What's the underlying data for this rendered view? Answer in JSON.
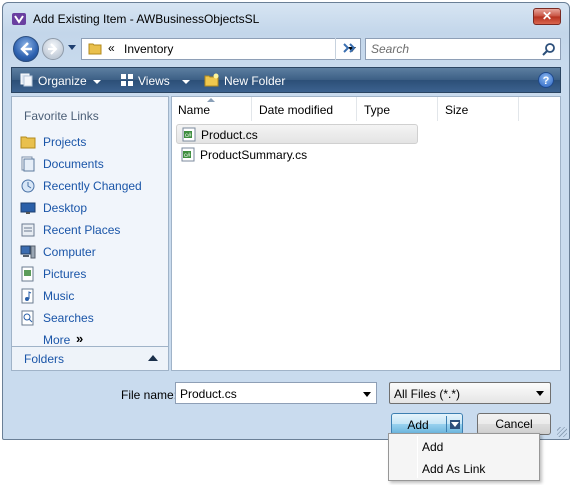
{
  "window": {
    "title": "Add Existing Item - AWBusinessObjectsSL",
    "close_label": "✕"
  },
  "nav": {
    "breadcrumb_prefix": "«",
    "current_folder": "Inventory",
    "search_placeholder": "Search"
  },
  "toolbar": {
    "organize_label": "Organize",
    "views_label": "Views",
    "new_folder_label": "New Folder",
    "help_label": "?"
  },
  "sidebar": {
    "header": "Favorite Links",
    "items": [
      {
        "label": "Projects",
        "icon": "folder-icon"
      },
      {
        "label": "Documents",
        "icon": "documents-icon"
      },
      {
        "label": "Recently Changed",
        "icon": "recently-changed-icon"
      },
      {
        "label": "Desktop",
        "icon": "desktop-icon"
      },
      {
        "label": "Recent Places",
        "icon": "recent-places-icon"
      },
      {
        "label": "Computer",
        "icon": "computer-icon"
      },
      {
        "label": "Pictures",
        "icon": "pictures-icon"
      },
      {
        "label": "Music",
        "icon": "music-icon"
      },
      {
        "label": "Searches",
        "icon": "searches-icon"
      }
    ],
    "more_label": "More",
    "more_chevron": "»",
    "folders_label": "Folders"
  },
  "files": {
    "columns": [
      "Name",
      "Date modified",
      "Type",
      "Size"
    ],
    "rows": [
      {
        "name": "Product.cs",
        "selected": true
      },
      {
        "name": "ProductSummary.cs",
        "selected": false
      }
    ]
  },
  "bottom": {
    "file_name_label": "File name:",
    "file_name_value": "Product.cs",
    "filter_value": "All Files (*.*)",
    "add_label": "Add",
    "cancel_label": "Cancel"
  },
  "add_menu": {
    "items": [
      "Add",
      "Add As Link"
    ]
  }
}
